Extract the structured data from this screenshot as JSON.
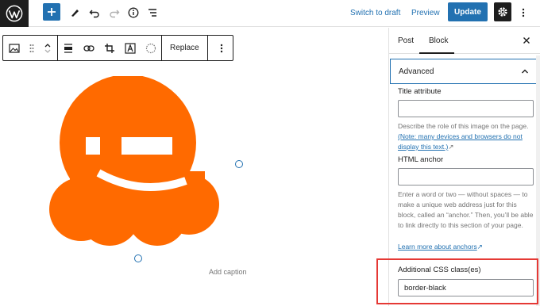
{
  "topbar": {
    "switch_to_draft": "Switch to draft",
    "preview": "Preview",
    "update": "Update"
  },
  "block_toolbar": {
    "replace_label": "Replace"
  },
  "canvas": {
    "caption_placeholder": "Add caption"
  },
  "sidebar": {
    "tabs": [
      "Post",
      "Block"
    ],
    "advanced_label": "Advanced",
    "title_attribute": {
      "label": "Title attribute",
      "value": "",
      "help": "Describe the role of this image on the page.",
      "help_link": "(Note: many devices and browsers do not display this text.)"
    },
    "html_anchor": {
      "label": "HTML anchor",
      "value": "",
      "help": "Enter a word or two — without spaces — to make a unique web address just for this block, called an “anchor.” Then, you’ll be able to link directly to this section of your page.",
      "help_link": "Learn more about anchors"
    },
    "css_classes": {
      "label": "Additional CSS class(es)",
      "value": "border-black"
    }
  },
  "colors": {
    "accent": "#2271b1",
    "logo_orange": "#ff6a00",
    "highlight": "#e53935"
  }
}
